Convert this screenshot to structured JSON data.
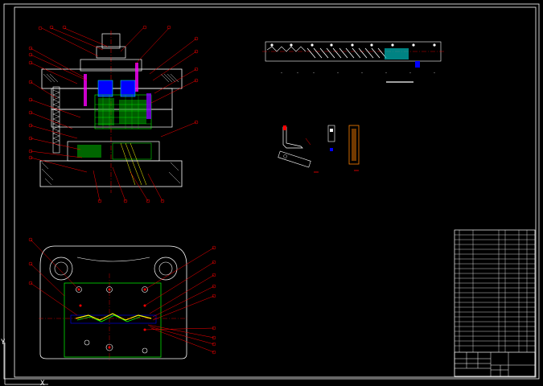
{
  "drawing": {
    "title_block": {
      "rows_text": [
        "",
        "",
        "",
        "",
        "",
        "",
        "",
        "",
        "",
        "",
        "",
        "",
        "",
        "",
        ""
      ],
      "bottom_left": [
        "",
        ""
      ],
      "bottom_right": [
        "",
        ""
      ]
    },
    "colors": {
      "background": "#000000",
      "frame": "#ffffff",
      "leader": "#ff0000",
      "part_green": "#00ff00",
      "part_blue": "#0000ff",
      "part_cyan": "#00ffff",
      "part_magenta": "#ff00ff",
      "part_yellow": "#ffff00",
      "part_orange": "#ff8000",
      "centerline": "#ff0000"
    },
    "ucs_icon": {
      "x_label": "X",
      "y_label": "Y"
    }
  }
}
